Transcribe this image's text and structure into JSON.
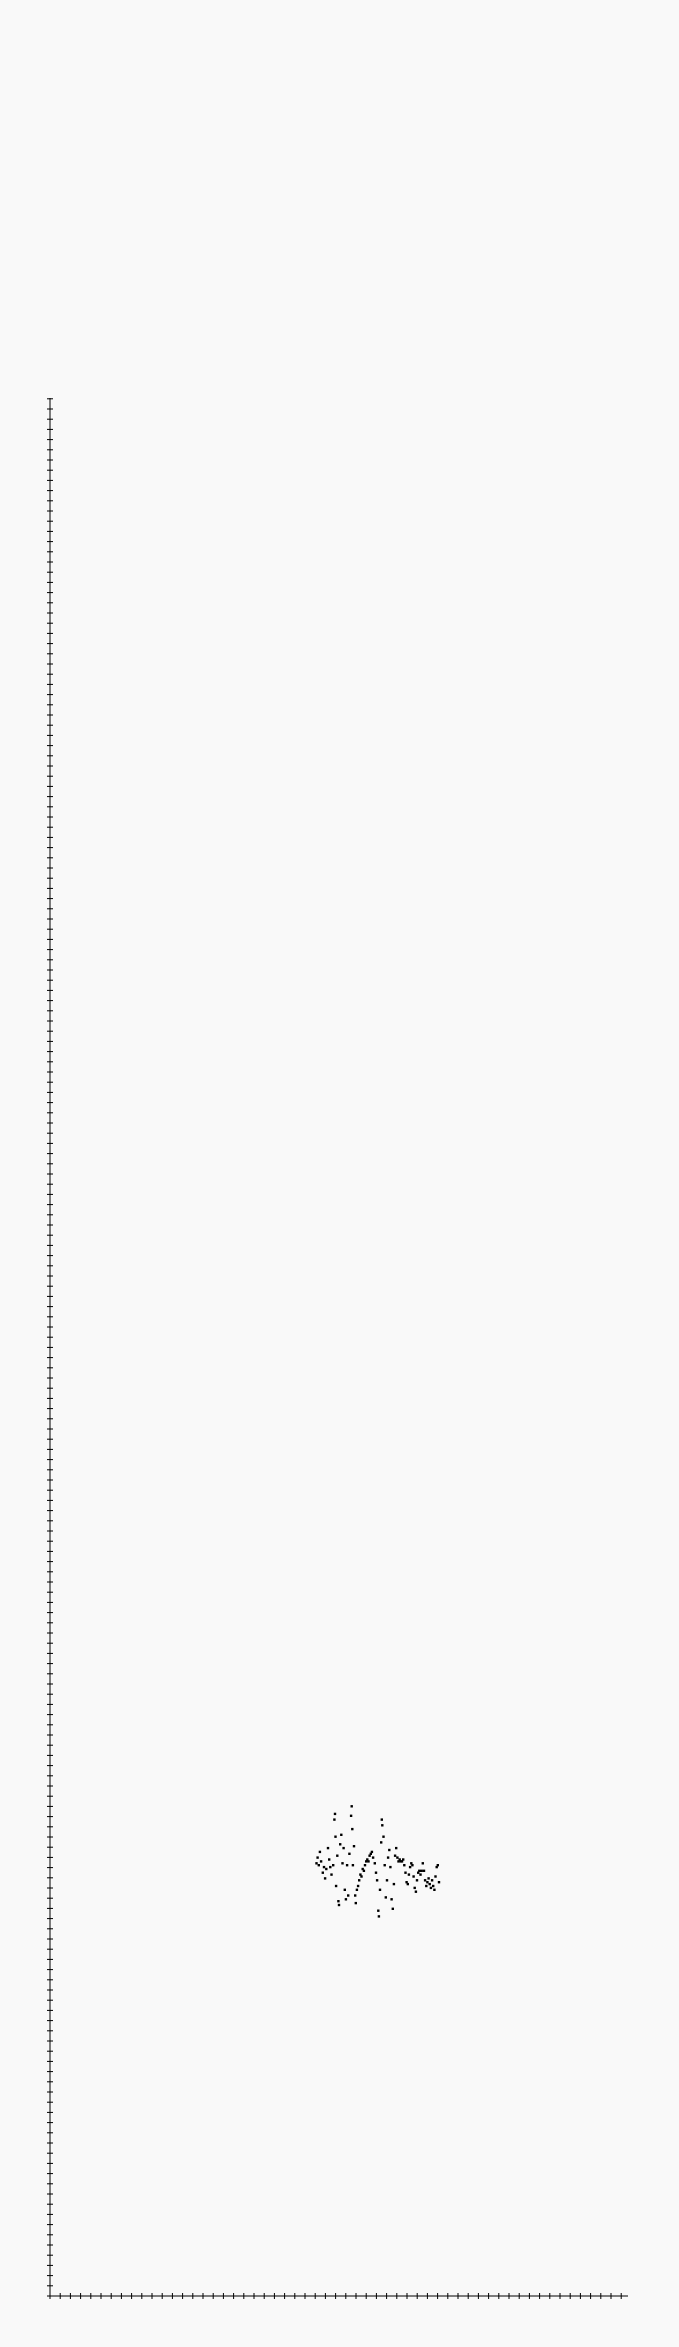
{
  "chart_data": {
    "type": "scatter",
    "title": "",
    "xlabel": "",
    "ylabel": "",
    "xlim": [
      0,
      1
    ],
    "ylim": [
      0,
      1
    ],
    "grid": false,
    "legend": "none",
    "colors": {
      "background": "#f9f9f9",
      "axis": "#000000",
      "points": "#000000"
    },
    "points": [
      {
        "x": 0.461,
        "y": 0.228
      },
      {
        "x": 0.463,
        "y": 0.231
      },
      {
        "x": 0.465,
        "y": 0.227
      },
      {
        "x": 0.467,
        "y": 0.234
      },
      {
        "x": 0.469,
        "y": 0.229
      },
      {
        "x": 0.472,
        "y": 0.223
      },
      {
        "x": 0.474,
        "y": 0.226
      },
      {
        "x": 0.476,
        "y": 0.22
      },
      {
        "x": 0.478,
        "y": 0.225
      },
      {
        "x": 0.481,
        "y": 0.236
      },
      {
        "x": 0.483,
        "y": 0.23
      },
      {
        "x": 0.485,
        "y": 0.226
      },
      {
        "x": 0.487,
        "y": 0.222
      },
      {
        "x": 0.49,
        "y": 0.227
      },
      {
        "x": 0.492,
        "y": 0.251
      },
      {
        "x": 0.493,
        "y": 0.254
      },
      {
        "x": 0.494,
        "y": 0.242
      },
      {
        "x": 0.495,
        "y": 0.216
      },
      {
        "x": 0.497,
        "y": 0.232
      },
      {
        "x": 0.499,
        "y": 0.208
      },
      {
        "x": 0.5,
        "y": 0.206
      },
      {
        "x": 0.502,
        "y": 0.238
      },
      {
        "x": 0.504,
        "y": 0.243
      },
      {
        "x": 0.506,
        "y": 0.228
      },
      {
        "x": 0.508,
        "y": 0.236
      },
      {
        "x": 0.51,
        "y": 0.214
      },
      {
        "x": 0.512,
        "y": 0.209
      },
      {
        "x": 0.514,
        "y": 0.227
      },
      {
        "x": 0.516,
        "y": 0.211
      },
      {
        "x": 0.518,
        "y": 0.233
      },
      {
        "x": 0.521,
        "y": 0.253
      },
      {
        "x": 0.522,
        "y": 0.258
      },
      {
        "x": 0.523,
        "y": 0.246
      },
      {
        "x": 0.524,
        "y": 0.227
      },
      {
        "x": 0.526,
        "y": 0.237
      },
      {
        "x": 0.528,
        "y": 0.211
      },
      {
        "x": 0.529,
        "y": 0.207
      },
      {
        "x": 0.531,
        "y": 0.214
      },
      {
        "x": 0.533,
        "y": 0.216
      },
      {
        "x": 0.535,
        "y": 0.219
      },
      {
        "x": 0.537,
        "y": 0.222
      },
      {
        "x": 0.539,
        "y": 0.221
      },
      {
        "x": 0.541,
        "y": 0.225
      },
      {
        "x": 0.543,
        "y": 0.224
      },
      {
        "x": 0.545,
        "y": 0.227
      },
      {
        "x": 0.547,
        "y": 0.229
      },
      {
        "x": 0.549,
        "y": 0.23
      },
      {
        "x": 0.551,
        "y": 0.229
      },
      {
        "x": 0.553,
        "y": 0.232
      },
      {
        "x": 0.555,
        "y": 0.233
      },
      {
        "x": 0.557,
        "y": 0.234
      },
      {
        "x": 0.559,
        "y": 0.231
      },
      {
        "x": 0.562,
        "y": 0.228
      },
      {
        "x": 0.564,
        "y": 0.223
      },
      {
        "x": 0.566,
        "y": 0.219
      },
      {
        "x": 0.568,
        "y": 0.203
      },
      {
        "x": 0.569,
        "y": 0.2
      },
      {
        "x": 0.571,
        "y": 0.214
      },
      {
        "x": 0.573,
        "y": 0.239
      },
      {
        "x": 0.574,
        "y": 0.251
      },
      {
        "x": 0.575,
        "y": 0.248
      },
      {
        "x": 0.577,
        "y": 0.242
      },
      {
        "x": 0.579,
        "y": 0.227
      },
      {
        "x": 0.581,
        "y": 0.21
      },
      {
        "x": 0.583,
        "y": 0.219
      },
      {
        "x": 0.585,
        "y": 0.231
      },
      {
        "x": 0.587,
        "y": 0.235
      },
      {
        "x": 0.589,
        "y": 0.226
      },
      {
        "x": 0.591,
        "y": 0.209
      },
      {
        "x": 0.593,
        "y": 0.204
      },
      {
        "x": 0.595,
        "y": 0.217
      },
      {
        "x": 0.597,
        "y": 0.232
      },
      {
        "x": 0.599,
        "y": 0.236
      },
      {
        "x": 0.601,
        "y": 0.231
      },
      {
        "x": 0.603,
        "y": 0.229
      },
      {
        "x": 0.605,
        "y": 0.23
      },
      {
        "x": 0.607,
        "y": 0.229
      },
      {
        "x": 0.609,
        "y": 0.229
      },
      {
        "x": 0.611,
        "y": 0.23
      },
      {
        "x": 0.613,
        "y": 0.227
      },
      {
        "x": 0.615,
        "y": 0.223
      },
      {
        "x": 0.617,
        "y": 0.218
      },
      {
        "x": 0.619,
        "y": 0.217
      },
      {
        "x": 0.621,
        "y": 0.222
      },
      {
        "x": 0.623,
        "y": 0.226
      },
      {
        "x": 0.625,
        "y": 0.228
      },
      {
        "x": 0.627,
        "y": 0.227
      },
      {
        "x": 0.629,
        "y": 0.221
      },
      {
        "x": 0.631,
        "y": 0.215
      },
      {
        "x": 0.633,
        "y": 0.213
      },
      {
        "x": 0.635,
        "y": 0.219
      },
      {
        "x": 0.637,
        "y": 0.223
      },
      {
        "x": 0.639,
        "y": 0.224
      },
      {
        "x": 0.641,
        "y": 0.222
      },
      {
        "x": 0.643,
        "y": 0.224
      },
      {
        "x": 0.645,
        "y": 0.228
      },
      {
        "x": 0.647,
        "y": 0.224
      },
      {
        "x": 0.649,
        "y": 0.219
      },
      {
        "x": 0.651,
        "y": 0.216
      },
      {
        "x": 0.653,
        "y": 0.218
      },
      {
        "x": 0.655,
        "y": 0.22
      },
      {
        "x": 0.657,
        "y": 0.217
      },
      {
        "x": 0.659,
        "y": 0.215
      },
      {
        "x": 0.661,
        "y": 0.219
      },
      {
        "x": 0.663,
        "y": 0.216
      },
      {
        "x": 0.665,
        "y": 0.214
      },
      {
        "x": 0.667,
        "y": 0.221
      },
      {
        "x": 0.669,
        "y": 0.226
      },
      {
        "x": 0.671,
        "y": 0.227
      },
      {
        "x": 0.673,
        "y": 0.218
      }
    ]
  }
}
